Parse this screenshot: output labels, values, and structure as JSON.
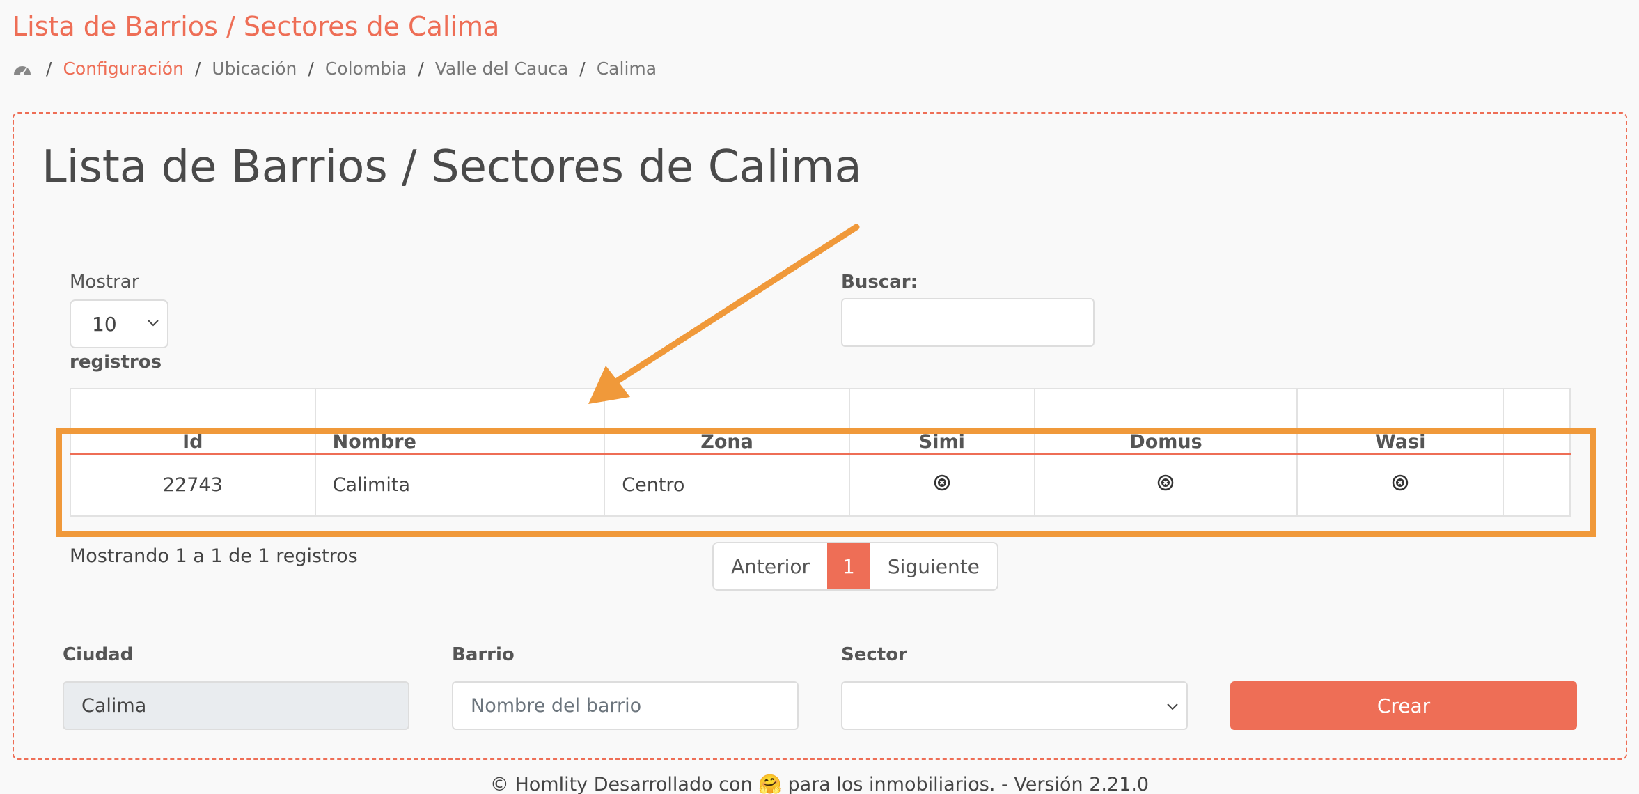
{
  "header": {
    "title": "Lista de Barrios / Sectores de Calima",
    "breadcrumb": [
      {
        "label": "Configuración",
        "link": true
      },
      {
        "label": "Ubicación",
        "link": false
      },
      {
        "label": "Colombia",
        "link": false
      },
      {
        "label": "Valle del Cauca",
        "link": false
      },
      {
        "label": "Calima",
        "link": false
      }
    ]
  },
  "card": {
    "title": "Lista de Barrios / Sectores de Calima",
    "show_label": "Mostrar",
    "show_value": "10",
    "records_label": "registros",
    "search_label": "Buscar:",
    "search_value": ""
  },
  "table": {
    "headers": [
      "Id",
      "Nombre",
      "Zona",
      "Simi",
      "Domus",
      "Wasi",
      ""
    ],
    "rows": [
      {
        "id": "22743",
        "nombre": "Calimita",
        "zona": "Centro",
        "simi": "x-circle-icon",
        "domus": "x-circle-icon",
        "wasi": "x-circle-icon"
      }
    ]
  },
  "pagination": {
    "info": "Mostrando 1 a 1 de 1 registros",
    "prev": "Anterior",
    "current": "1",
    "next": "Siguiente"
  },
  "form": {
    "city_label": "Ciudad",
    "city_value": "Calima",
    "barrio_label": "Barrio",
    "barrio_placeholder": "Nombre del barrio",
    "sector_label": "Sector",
    "sector_value": "",
    "create_label": "Crear"
  },
  "footer": {
    "text": "© Homlity Desarrollado con 🤗 para los inmobiliarios. - Versión 2.21.0"
  },
  "colors": {
    "accent": "#ee6e56",
    "highlight": "#f0993a"
  }
}
